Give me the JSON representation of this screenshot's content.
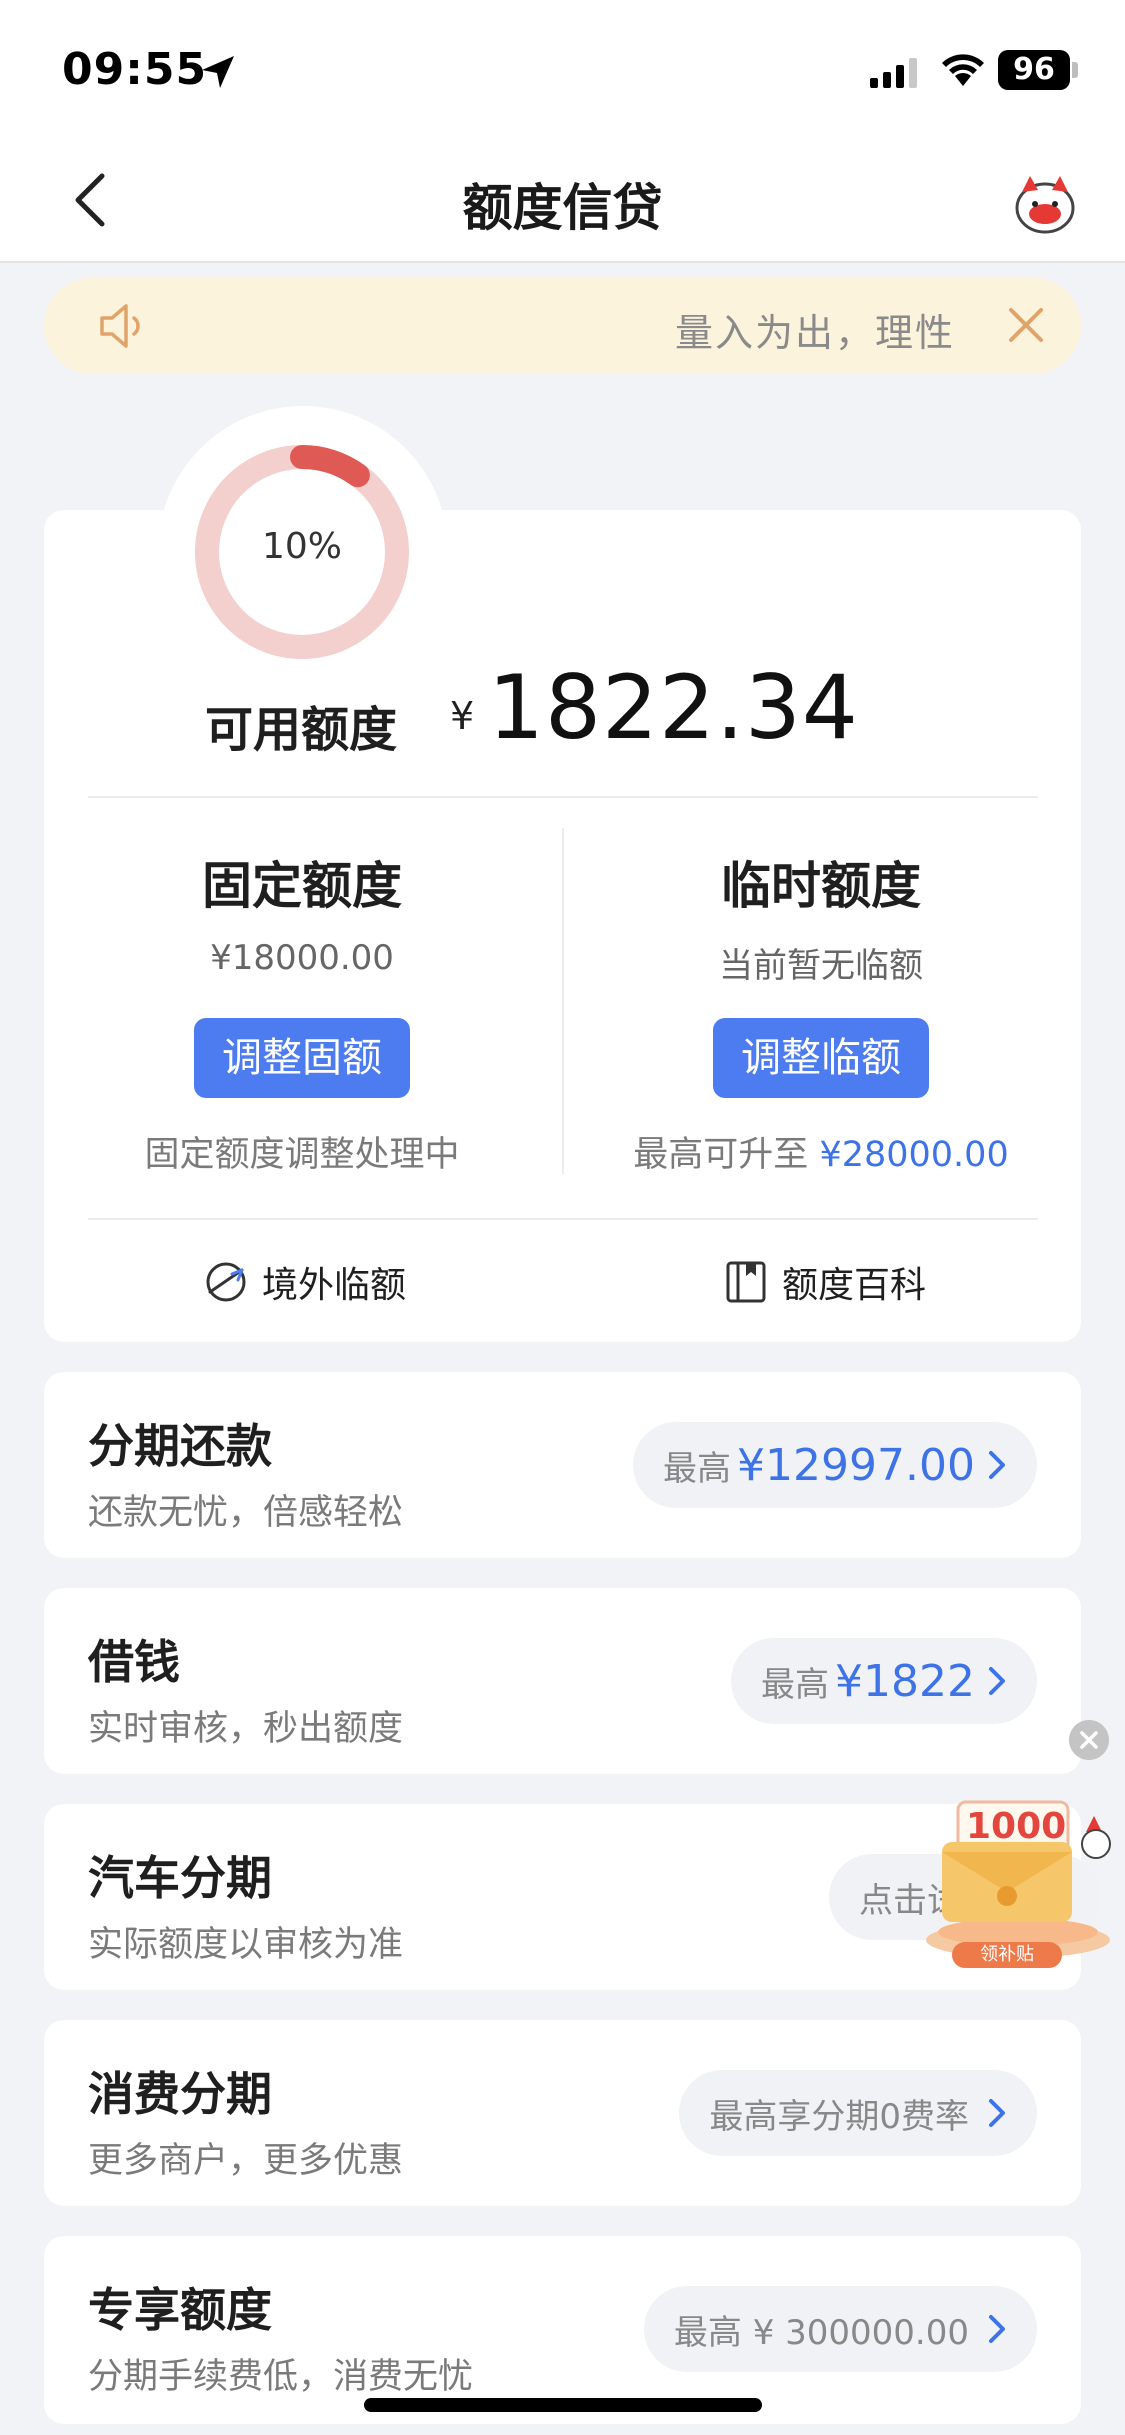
{
  "status_bar": {
    "time": "09:55",
    "battery": "96"
  },
  "nav": {
    "title": "额度信贷"
  },
  "notice": {
    "text": "量入为出，理性"
  },
  "credit": {
    "usage_percent_label": "10%",
    "usage_fraction": 0.1,
    "available_label": "可用额度",
    "currency": "¥",
    "available_amount": "1822.34",
    "fixed": {
      "title": "固定额度",
      "amount": "¥18000.00",
      "button": "调整固额",
      "note": "固定额度调整处理中"
    },
    "temporary": {
      "title": "临时额度",
      "status": "当前暂无临额",
      "button": "调整临额",
      "note_prefix": "最高可升至",
      "note_amount": "¥28000.00"
    },
    "links": [
      {
        "label": "境外临额",
        "icon": "overseas-icon"
      },
      {
        "label": "额度百科",
        "icon": "book-icon"
      }
    ]
  },
  "products": [
    {
      "title": "分期还款",
      "subtitle": "还款无忧，倍感轻松",
      "pill_prefix": "最高",
      "pill_amount": "¥12997.00"
    },
    {
      "title": "借钱",
      "subtitle": "实时审核，秒出额度",
      "pill_prefix": "最高",
      "pill_amount": "¥1822"
    },
    {
      "title": "汽车分期",
      "subtitle": "实际额度以审核为准",
      "pill_prefix": "点击试",
      "pill_amount": ""
    },
    {
      "title": "消费分期",
      "subtitle": "更多商户，更多优惠",
      "pill_prefix": "最高享分期0费率",
      "pill_amount": ""
    },
    {
      "title": "专享额度",
      "subtitle": "分期手续费低，消费无忧",
      "pill_prefix": "最高 ¥ 300000.00",
      "pill_amount": ""
    }
  ],
  "float_ad": {
    "amount": "1000",
    "label": "领补贴"
  },
  "colors": {
    "accent_blue": "#4c7cf0",
    "ring_red": "#e05a55",
    "ring_track": "#f3cfcd",
    "notice_bg": "#fcf3dc"
  }
}
